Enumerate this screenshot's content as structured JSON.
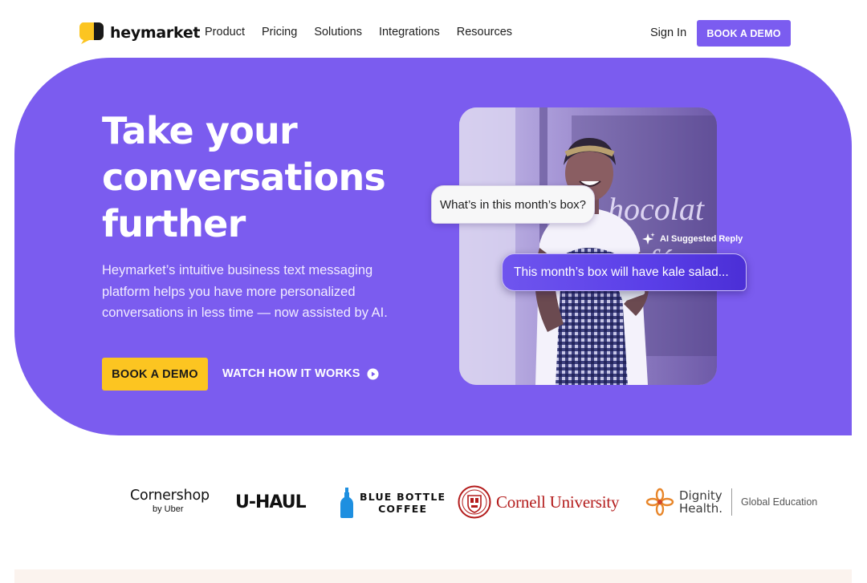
{
  "brand": {
    "name": "heymarket",
    "accent": "#7b5cef",
    "yellow": "#fcc521"
  },
  "nav": {
    "links": [
      "Product",
      "Pricing",
      "Solutions",
      "Integrations",
      "Resources"
    ],
    "sign_in": "Sign In",
    "cta": "BOOK A DEMO"
  },
  "hero": {
    "title_lines": [
      "Take your",
      "conversations",
      "further"
    ],
    "subtitle": "Heymarket’s intuitive business text messaging platform helps you have more personalized conversations in less time — now assisted by AI.",
    "primary_cta": "BOOK A DEMO",
    "secondary_cta": "WATCH HOW IT WORKS",
    "secondary_icon": "play-circle-icon",
    "chat": {
      "question": "What’s in this month’s box?",
      "ai_label": "AI Suggested Reply",
      "ai_icon": "sparkle-icon",
      "answer": "This month’s box will have kale salad..."
    }
  },
  "logos": {
    "cornershop": {
      "name": "Cornershop",
      "sub": "by Uber"
    },
    "uhaul": "U-HAUL",
    "bluebottle": {
      "line1": "BLUE BOTTLE",
      "line2": "COFFEE"
    },
    "cornell": "Cornell University",
    "dignity": {
      "line1": "Dignity",
      "line2": "Health.",
      "sub": "Global Education"
    }
  }
}
